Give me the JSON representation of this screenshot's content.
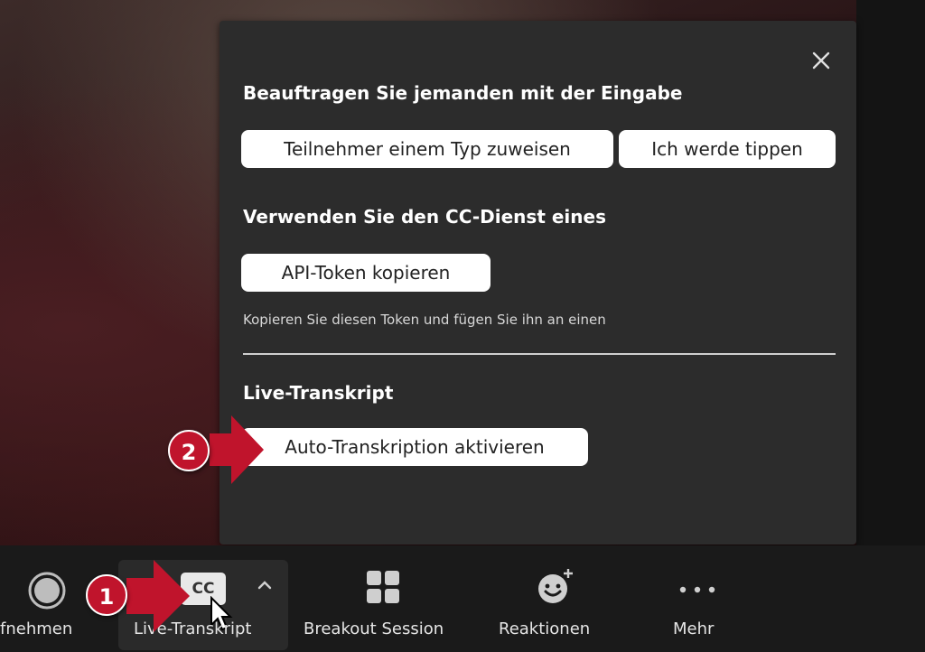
{
  "popup": {
    "section1_title": "Beauftragen Sie jemanden mit der Eingabe",
    "assign_button": "Teilnehmer einem Typ zuweisen",
    "type_button": "Ich werde tippen",
    "section2_title": "Verwenden Sie den CC-Dienst eines",
    "api_button": "API-Token kopieren",
    "api_hint": "Kopieren Sie diesen Token und fügen Sie ihn an einen",
    "section3_title": "Live-Transkript",
    "auto_button": "Auto-Transkription aktivieren"
  },
  "toolbar": {
    "record_label": "fnehmen",
    "cc_icon_text": "CC",
    "live_label": "Live-Transkript",
    "breakout_label": "Breakout Session",
    "reactions_label": "Reaktionen",
    "more_label": "Mehr"
  },
  "callouts": {
    "step1": "1",
    "step2": "2"
  },
  "colors": {
    "callout": "#c0142c",
    "popup_bg": "#2c2c2c",
    "toolbar_bg": "#1a1a1a"
  }
}
